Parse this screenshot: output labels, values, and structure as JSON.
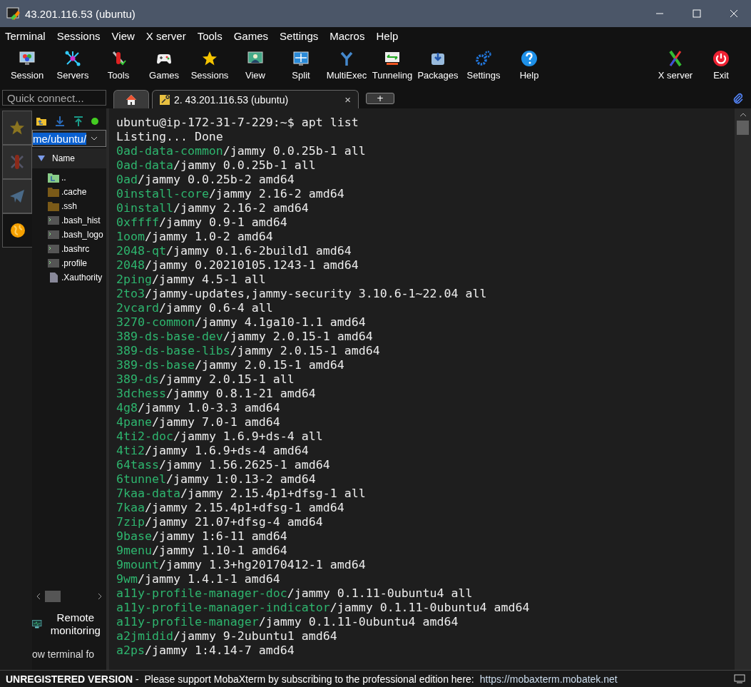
{
  "window": {
    "title": "43.201.116.53 (ubuntu)"
  },
  "menu": [
    "Terminal",
    "Sessions",
    "View",
    "X server",
    "Tools",
    "Games",
    "Settings",
    "Macros",
    "Help"
  ],
  "toolbar": {
    "left": [
      "Session",
      "Servers",
      "Tools",
      "Games",
      "Sessions",
      "View",
      "Split",
      "MultiExec",
      "Tunneling",
      "Packages",
      "Settings",
      "Help"
    ],
    "right": [
      "X server",
      "Exit"
    ]
  },
  "quick_connect": {
    "placeholder": "Quick connect..."
  },
  "tabs": [
    {
      "kind": "home",
      "selected": false
    },
    {
      "kind": "session",
      "label": "2. 43.201.116.53 (ubuntu)",
      "close": "×",
      "selected": true
    },
    {
      "kind": "new",
      "label": "+",
      "selected": false
    }
  ],
  "sidebar_tabs": [
    {
      "selected": false
    },
    {
      "selected": false
    },
    {
      "selected": false
    },
    {
      "selected": true
    }
  ],
  "file_browser": {
    "path": "me/ubuntu/",
    "column": "Name",
    "files": [
      {
        "name": "..",
        "kind": "parent"
      },
      {
        "name": ".cache",
        "kind": "folder"
      },
      {
        "name": ".ssh",
        "kind": "folder"
      },
      {
        "name": ".bash_hist",
        "kind": "script"
      },
      {
        "name": ".bash_logo",
        "kind": "script"
      },
      {
        "name": ".bashrc",
        "kind": "script"
      },
      {
        "name": ".profile",
        "kind": "script"
      },
      {
        "name": ".Xauthority",
        "kind": "file"
      }
    ],
    "remote_monitoring": "Remote monitoring",
    "follow_terminal": "ow terminal fo"
  },
  "terminal": {
    "lines": [
      {
        "kind": "plain",
        "text": "ubuntu@ip-172-31-7-229:~$ apt list"
      },
      {
        "kind": "plain",
        "text": "Listing... Done"
      },
      {
        "kind": "package",
        "name": "0ad-data-common",
        "rest": "/jammy 0.0.25b-1 all"
      },
      {
        "kind": "package",
        "name": "0ad-data",
        "rest": "/jammy 0.0.25b-1 all"
      },
      {
        "kind": "package",
        "name": "0ad",
        "rest": "/jammy 0.0.25b-2 amd64"
      },
      {
        "kind": "package",
        "name": "0install-core",
        "rest": "/jammy 2.16-2 amd64"
      },
      {
        "kind": "package",
        "name": "0install",
        "rest": "/jammy 2.16-2 amd64"
      },
      {
        "kind": "package",
        "name": "0xffff",
        "rest": "/jammy 0.9-1 amd64"
      },
      {
        "kind": "package",
        "name": "1oom",
        "rest": "/jammy 1.0-2 amd64"
      },
      {
        "kind": "package",
        "name": "2048-qt",
        "rest": "/jammy 0.1.6-2build1 amd64"
      },
      {
        "kind": "package",
        "name": "2048",
        "rest": "/jammy 0.20210105.1243-1 amd64"
      },
      {
        "kind": "package",
        "name": "2ping",
        "rest": "/jammy 4.5-1 all"
      },
      {
        "kind": "package",
        "name": "2to3",
        "rest": "/jammy-updates,jammy-security 3.10.6-1~22.04 all"
      },
      {
        "kind": "package",
        "name": "2vcard",
        "rest": "/jammy 0.6-4 all"
      },
      {
        "kind": "package",
        "name": "3270-common",
        "rest": "/jammy 4.1ga10-1.1 amd64"
      },
      {
        "kind": "package",
        "name": "389-ds-base-dev",
        "rest": "/jammy 2.0.15-1 amd64"
      },
      {
        "kind": "package",
        "name": "389-ds-base-libs",
        "rest": "/jammy 2.0.15-1 amd64"
      },
      {
        "kind": "package",
        "name": "389-ds-base",
        "rest": "/jammy 2.0.15-1 amd64"
      },
      {
        "kind": "package",
        "name": "389-ds",
        "rest": "/jammy 2.0.15-1 all"
      },
      {
        "kind": "package",
        "name": "3dchess",
        "rest": "/jammy 0.8.1-21 amd64"
      },
      {
        "kind": "package",
        "name": "4g8",
        "rest": "/jammy 1.0-3.3 amd64"
      },
      {
        "kind": "package",
        "name": "4pane",
        "rest": "/jammy 7.0-1 amd64"
      },
      {
        "kind": "package",
        "name": "4ti2-doc",
        "rest": "/jammy 1.6.9+ds-4 all"
      },
      {
        "kind": "package",
        "name": "4ti2",
        "rest": "/jammy 1.6.9+ds-4 amd64"
      },
      {
        "kind": "package",
        "name": "64tass",
        "rest": "/jammy 1.56.2625-1 amd64"
      },
      {
        "kind": "package",
        "name": "6tunnel",
        "rest": "/jammy 1:0.13-2 amd64"
      },
      {
        "kind": "package",
        "name": "7kaa-data",
        "rest": "/jammy 2.15.4p1+dfsg-1 all"
      },
      {
        "kind": "package",
        "name": "7kaa",
        "rest": "/jammy 2.15.4p1+dfsg-1 amd64"
      },
      {
        "kind": "package",
        "name": "7zip",
        "rest": "/jammy 21.07+dfsg-4 amd64"
      },
      {
        "kind": "package",
        "name": "9base",
        "rest": "/jammy 1:6-11 amd64"
      },
      {
        "kind": "package",
        "name": "9menu",
        "rest": "/jammy 1.10-1 amd64"
      },
      {
        "kind": "package",
        "name": "9mount",
        "rest": "/jammy 1.3+hg20170412-1 amd64"
      },
      {
        "kind": "package",
        "name": "9wm",
        "rest": "/jammy 1.4.1-1 amd64"
      },
      {
        "kind": "package",
        "name": "a11y-profile-manager-doc",
        "rest": "/jammy 0.1.11-0ubuntu4 all"
      },
      {
        "kind": "package",
        "name": "a11y-profile-manager-indicator",
        "rest": "/jammy 0.1.11-0ubuntu4 amd64"
      },
      {
        "kind": "package",
        "name": "a11y-profile-manager",
        "rest": "/jammy 0.1.11-0ubuntu4 amd64"
      },
      {
        "kind": "package",
        "name": "a2jmidid",
        "rest": "/jammy 9-2ubuntu1 amd64"
      },
      {
        "kind": "package",
        "name": "a2ps",
        "rest": "/jammy 1:4.14-7 amd64"
      }
    ]
  },
  "status_bar": {
    "notice": "UNREGISTERED VERSION",
    "message": " -  Please support MobaXterm by subscribing to the professional edition here:",
    "link": "https://mobaxterm.mobatek.net"
  }
}
